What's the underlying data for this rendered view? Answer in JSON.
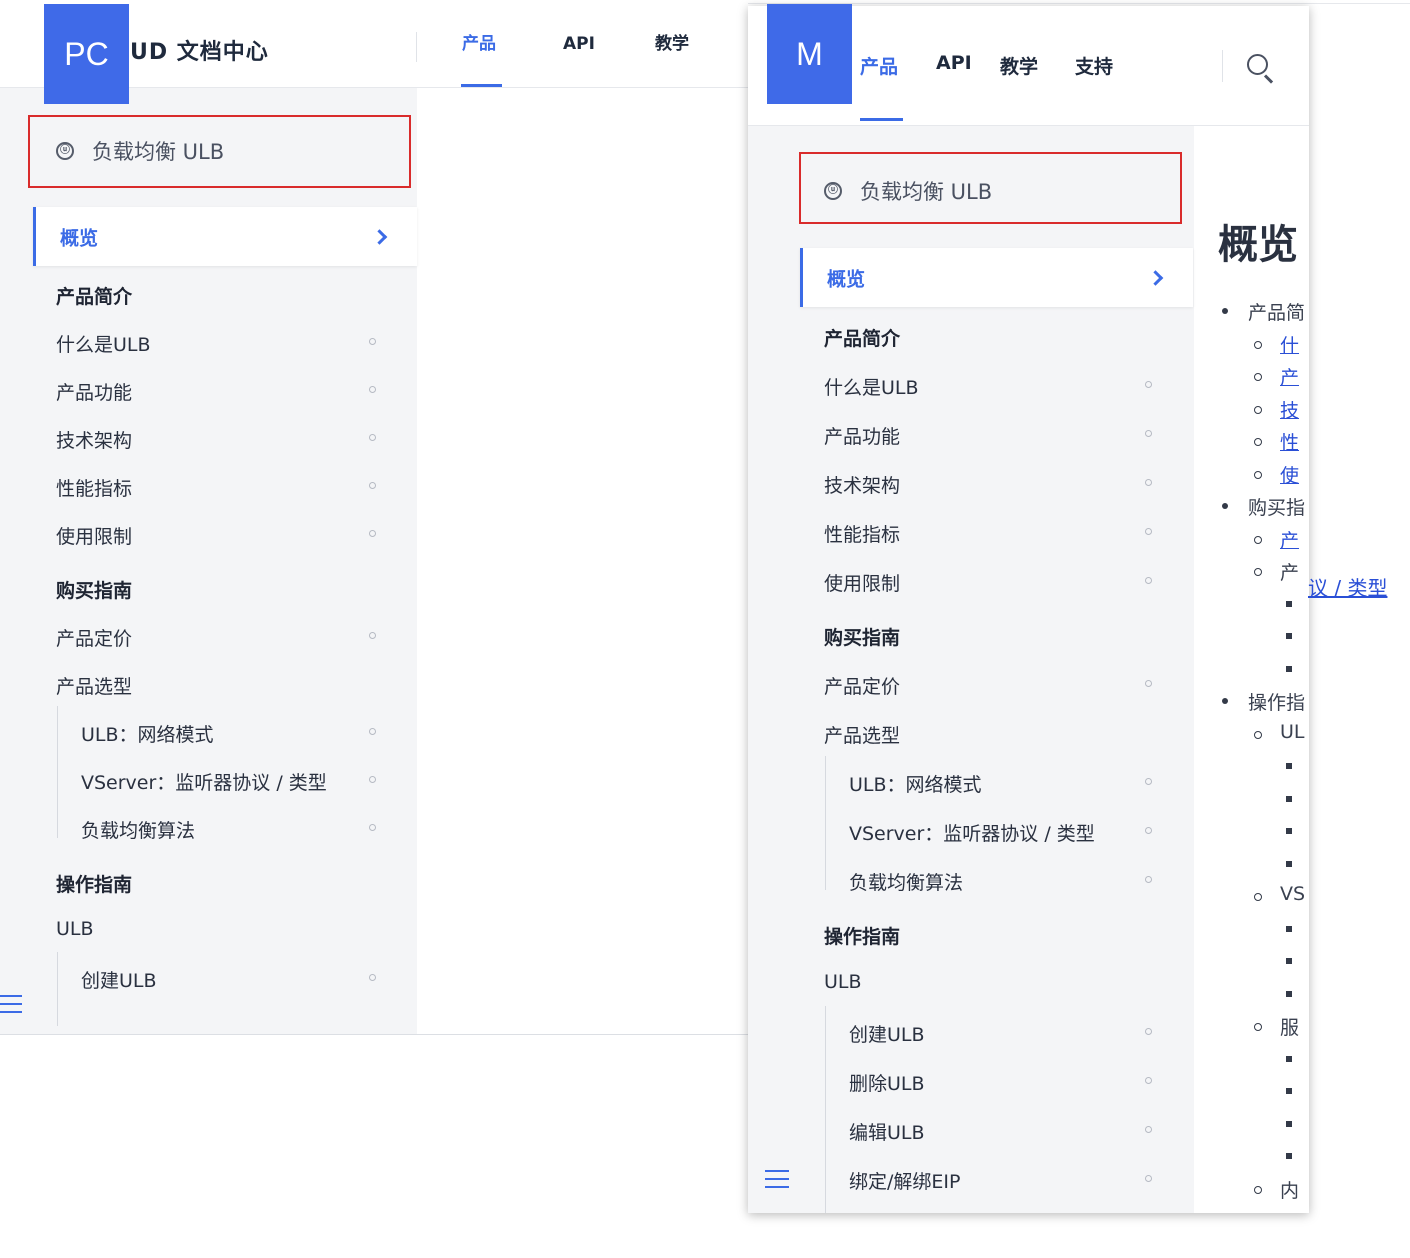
{
  "pc": {
    "badge": "PC",
    "logo": "UD 文档中心",
    "nav": [
      "产品",
      "API",
      "教学"
    ],
    "product_title": "负载均衡 ULB",
    "selected": "概览",
    "items": [
      {
        "label": "产品简介",
        "kind": "section"
      },
      {
        "label": "什么是ULB",
        "kind": "item"
      },
      {
        "label": "产品功能",
        "kind": "item"
      },
      {
        "label": "技术架构",
        "kind": "item"
      },
      {
        "label": "性能指标",
        "kind": "item"
      },
      {
        "label": "使用限制",
        "kind": "item"
      },
      {
        "label": "购买指南",
        "kind": "section"
      },
      {
        "label": "产品定价",
        "kind": "item"
      },
      {
        "label": "产品选型",
        "kind": "group"
      },
      {
        "label": "ULB：网络模式",
        "kind": "sub"
      },
      {
        "label": "VServer：监听器协议 / 类型",
        "kind": "sub"
      },
      {
        "label": "负载均衡算法",
        "kind": "sub"
      },
      {
        "label": "操作指南",
        "kind": "section"
      },
      {
        "label": "ULB",
        "kind": "group"
      },
      {
        "label": "创建ULB",
        "kind": "sub"
      }
    ]
  },
  "mobile": {
    "badge": "M",
    "nav": [
      "产品",
      "API",
      "教学",
      "支持"
    ],
    "product_title": "负载均衡 ULB",
    "selected": "概览",
    "items": [
      {
        "label": "产品简介",
        "kind": "section"
      },
      {
        "label": "什么是ULB",
        "kind": "item"
      },
      {
        "label": "产品功能",
        "kind": "item"
      },
      {
        "label": "技术架构",
        "kind": "item"
      },
      {
        "label": "性能指标",
        "kind": "item"
      },
      {
        "label": "使用限制",
        "kind": "item"
      },
      {
        "label": "购买指南",
        "kind": "section"
      },
      {
        "label": "产品定价",
        "kind": "item"
      },
      {
        "label": "产品选型",
        "kind": "group"
      },
      {
        "label": "ULB：网络模式",
        "kind": "sub"
      },
      {
        "label": "VServer：监听器协议 / 类型",
        "kind": "sub"
      },
      {
        "label": "负载均衡算法",
        "kind": "sub"
      },
      {
        "label": "操作指南",
        "kind": "section"
      },
      {
        "label": "ULB",
        "kind": "group"
      },
      {
        "label": "创建ULB",
        "kind": "sub"
      },
      {
        "label": "删除ULB",
        "kind": "sub"
      },
      {
        "label": "编辑ULB",
        "kind": "sub"
      },
      {
        "label": "绑定/解绑EIP",
        "kind": "sub"
      }
    ],
    "content": {
      "heading": "概览",
      "overflow_link": "议 / 类型",
      "toc": [
        {
          "bullet": "disc",
          "text": "产品简",
          "link": false
        },
        {
          "bullet": "circle",
          "text": "什",
          "link": true
        },
        {
          "bullet": "circle",
          "text": "产",
          "link": true
        },
        {
          "bullet": "circle",
          "text": "技",
          "link": true
        },
        {
          "bullet": "circle",
          "text": "性",
          "link": true
        },
        {
          "bullet": "circle",
          "text": "使",
          "link": true
        },
        {
          "bullet": "disc",
          "text": "购买指",
          "link": false
        },
        {
          "bullet": "circle",
          "text": "产",
          "link": true
        },
        {
          "bullet": "circle",
          "text": "产",
          "link": false
        },
        {
          "bullet": "square",
          "text": "",
          "link": false
        },
        {
          "bullet": "square",
          "text": "",
          "link": false
        },
        {
          "bullet": "square",
          "text": "",
          "link": false
        },
        {
          "bullet": "disc",
          "text": "操作指",
          "link": false
        },
        {
          "bullet": "circle",
          "text": "UL",
          "link": false
        },
        {
          "bullet": "square",
          "text": "",
          "link": false
        },
        {
          "bullet": "square",
          "text": "",
          "link": false
        },
        {
          "bullet": "square",
          "text": "",
          "link": false
        },
        {
          "bullet": "square",
          "text": "",
          "link": false
        },
        {
          "bullet": "circle",
          "text": "VS",
          "link": false
        },
        {
          "bullet": "square",
          "text": "",
          "link": false
        },
        {
          "bullet": "square",
          "text": "",
          "link": false
        },
        {
          "bullet": "square",
          "text": "",
          "link": false
        },
        {
          "bullet": "circle",
          "text": "服",
          "link": false
        },
        {
          "bullet": "square",
          "text": "",
          "link": false
        },
        {
          "bullet": "square",
          "text": "",
          "link": false
        },
        {
          "bullet": "square",
          "text": "",
          "link": false
        },
        {
          "bullet": "square",
          "text": "",
          "link": false
        },
        {
          "bullet": "circle",
          "text": "内",
          "link": false
        }
      ]
    }
  },
  "colors": {
    "accent": "#3b6be6",
    "badge": "#3f6ae8",
    "highlight_box": "#d92b2b",
    "sidebar_bg": "#f4f5f7"
  }
}
